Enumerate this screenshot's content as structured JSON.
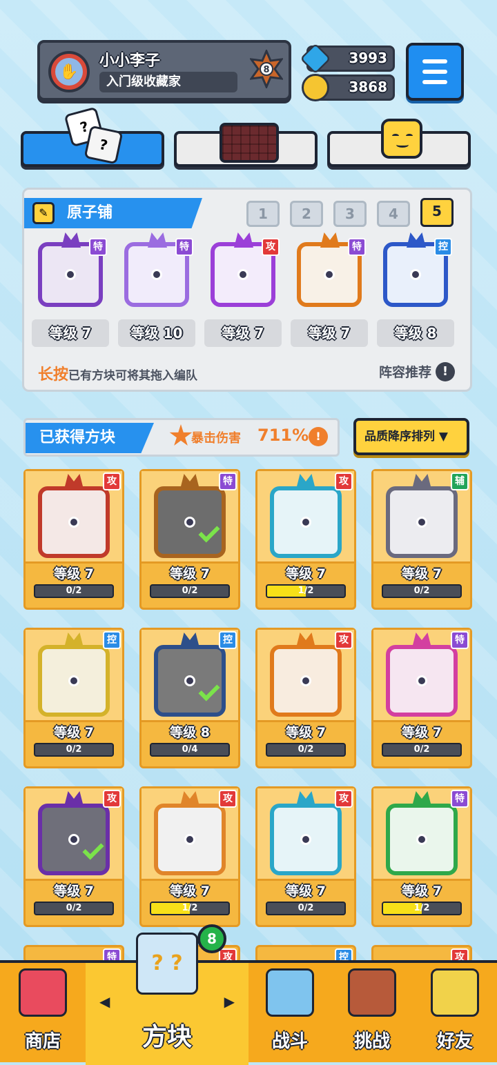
{
  "profile": {
    "name": "小小李子",
    "title": "入门级收藏家",
    "rank": "8"
  },
  "resources": {
    "gems": "3993",
    "coins": "3868"
  },
  "tabs": [
    "dice",
    "board",
    "emote"
  ],
  "deck": {
    "title": "原子铺",
    "slots": [
      "1",
      "2",
      "3",
      "4",
      "5"
    ],
    "active_slot": "5",
    "cards": [
      {
        "badge": "特",
        "type": "spc",
        "level": "等级 7",
        "color": "#7a3fc0",
        "bg": "#ece6f4"
      },
      {
        "badge": "特",
        "type": "spc",
        "level": "等级 10",
        "color": "#9b6ce0",
        "bg": "#f1ecfb"
      },
      {
        "badge": "攻",
        "type": "atk",
        "level": "等级 7",
        "color": "#9b3fd8",
        "bg": "#f3ecfb"
      },
      {
        "badge": "特",
        "type": "spc",
        "level": "等级 7",
        "color": "#e07a1c",
        "bg": "#f8f1e7"
      },
      {
        "badge": "控",
        "type": "ctl",
        "level": "等级 8",
        "color": "#2d58c8",
        "bg": "#e9f0fb"
      }
    ],
    "hint_em": "长按",
    "hint": "已有方块可将其拖入编队",
    "recommend": "阵容推荐"
  },
  "owned": {
    "title": "已获得方块",
    "crit_label": "暴击伤害",
    "crit_value": "711%",
    "sort_label": "品质降序排列 ▼",
    "cards": [
      {
        "badge": "攻",
        "type": "atk",
        "level": "等级 7",
        "progress": "0/2",
        "fill": 0,
        "color": "#c03a2a",
        "bg": "#f4e8e6",
        "check": false
      },
      {
        "badge": "特",
        "type": "spc",
        "level": "等级 7",
        "progress": "0/2",
        "fill": 0,
        "color": "#a8641f",
        "bg": "#6d6d6d",
        "check": true
      },
      {
        "badge": "攻",
        "type": "atk",
        "level": "等级 7",
        "progress": "1/2",
        "fill": 0.5,
        "color": "#2aa6c8",
        "bg": "#e6f4f8",
        "check": false
      },
      {
        "badge": "辅",
        "type": "sup",
        "level": "等级 7",
        "progress": "0/2",
        "fill": 0,
        "color": "#6a6a7e",
        "bg": "#ececf0",
        "check": false
      },
      {
        "badge": "控",
        "type": "ctl",
        "level": "等级 7",
        "progress": "0/2",
        "fill": 0,
        "color": "#d4b22a",
        "bg": "#f4efdc",
        "check": false
      },
      {
        "badge": "控",
        "type": "ctl",
        "level": "等级 8",
        "progress": "0/4",
        "fill": 0,
        "color": "#2d4f8a",
        "bg": "#7a7a7a",
        "check": true
      },
      {
        "badge": "攻",
        "type": "atk",
        "level": "等级 7",
        "progress": "0/2",
        "fill": 0,
        "color": "#e07a1c",
        "bg": "#f8ecdf",
        "check": false
      },
      {
        "badge": "特",
        "type": "spc",
        "level": "等级 7",
        "progress": "0/2",
        "fill": 0,
        "color": "#d33fa0",
        "bg": "#f6e6f1",
        "check": false
      },
      {
        "badge": "攻",
        "type": "atk",
        "level": "等级 7",
        "progress": "0/2",
        "fill": 0,
        "color": "#6a2fa8",
        "bg": "#6f6f7a",
        "check": true
      },
      {
        "badge": "攻",
        "type": "atk",
        "level": "等级 7",
        "progress": "1/2",
        "fill": 0.5,
        "color": "#e0852a",
        "bg": "#f1f1f1",
        "check": false
      },
      {
        "badge": "攻",
        "type": "atk",
        "level": "等级 7",
        "progress": "0/2",
        "fill": 0,
        "color": "#2aa6c8",
        "bg": "#e6f4f8",
        "check": false
      },
      {
        "badge": "特",
        "type": "spc",
        "level": "等级 7",
        "progress": "1/2",
        "fill": 0.5,
        "color": "#2fa84a",
        "bg": "#eaf6ec",
        "check": false
      }
    ],
    "peek_badges": [
      "特",
      "攻",
      "控",
      "攻"
    ]
  },
  "nav": {
    "items": [
      "商店",
      "方块",
      "战斗",
      "挑战",
      "好友"
    ],
    "active": "方块",
    "notification": "8"
  }
}
